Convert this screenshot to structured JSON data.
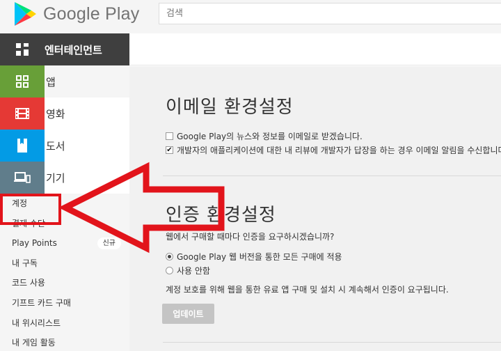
{
  "header": {
    "brand": "Google Play",
    "search_placeholder": "검색"
  },
  "category": {
    "label": "엔터테인먼트"
  },
  "sidebar": {
    "nav": [
      {
        "label": "앱",
        "color": "#689f38"
      },
      {
        "label": "영화",
        "color": "#e53935"
      },
      {
        "label": "도서",
        "color": "#039be5"
      },
      {
        "label": "기기",
        "color": "#607d8b"
      }
    ],
    "account_links": [
      {
        "label": "계정"
      },
      {
        "label": "결제 수단"
      },
      {
        "label": "Play Points",
        "badge": "신규"
      },
      {
        "label": "내 구독"
      },
      {
        "label": "코드 사용"
      },
      {
        "label": "기프트 카드 구매"
      },
      {
        "label": "내 위시리스트"
      },
      {
        "label": "내 게임 활동"
      }
    ]
  },
  "email_settings": {
    "title": "이메일 환경설정",
    "options": [
      {
        "label": "Google Play의 뉴스와 정보를 이메일로 받겠습니다.",
        "checked": false
      },
      {
        "label": "개발자의 애플리케이션에 대한 내 리뷰에 개발자가 답장을 하는 경우 이메일 알림을 수신합니다.",
        "checked": true
      }
    ]
  },
  "auth_settings": {
    "title": "인증 환경설정",
    "question": "웹에서 구매할 때마다 인증을 요구하시겠습니까?",
    "options": [
      {
        "label": "Google Play 웹 버전을 통한 모든 구매에 적용",
        "selected": true
      },
      {
        "label": "사용 안함",
        "selected": false
      }
    ],
    "note": "계정 보호를 위해 웹을 통한 유료 앱 구매 및 설치 시 계속해서 인증이 요구됩니다.",
    "update_label": "업데이트"
  },
  "annotation": {
    "color": "#e2141b"
  }
}
